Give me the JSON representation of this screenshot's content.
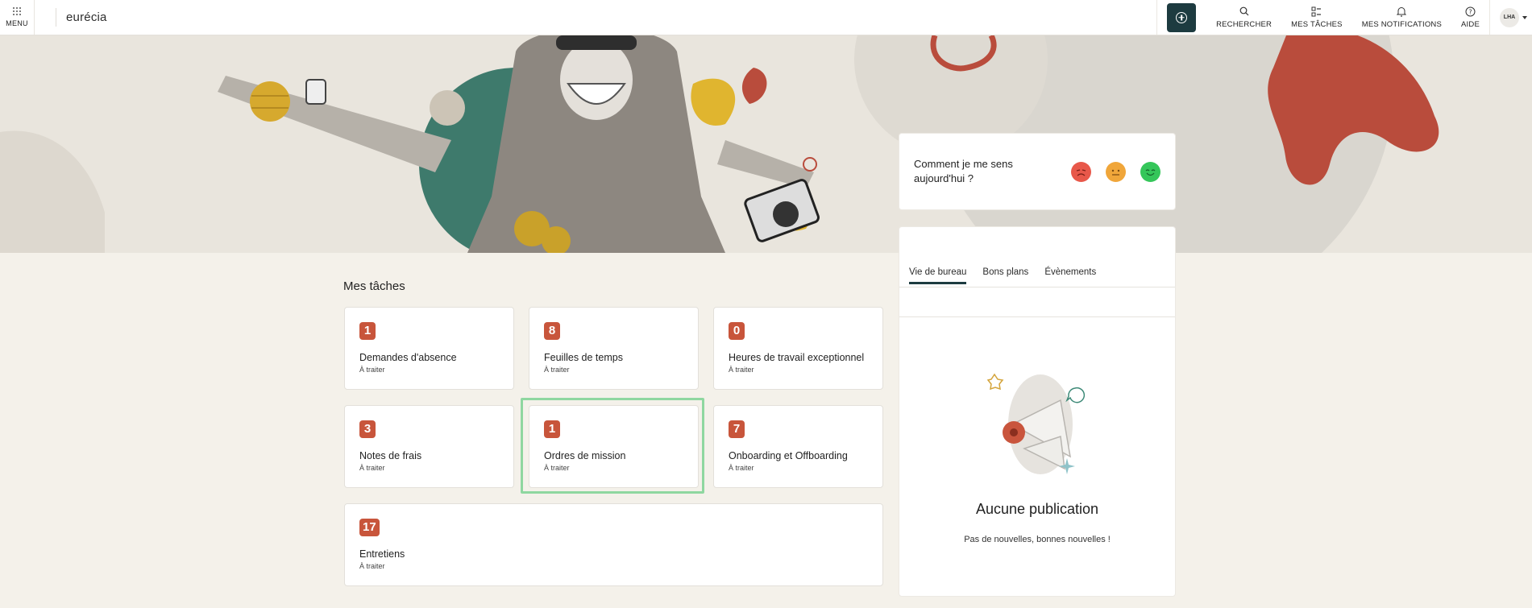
{
  "topbar": {
    "menu_label": "MENU",
    "logo": "eurécia",
    "nav": [
      {
        "label": "RECHERCHER",
        "icon": "search-icon"
      },
      {
        "label": "MES TÂCHES",
        "icon": "tasks-icon"
      },
      {
        "label": "MES NOTIFICATIONS",
        "icon": "bell-icon"
      },
      {
        "label": "AIDE",
        "icon": "help-icon"
      }
    ],
    "avatar": "LHA"
  },
  "mood": {
    "question": "Comment je me sens aujourd'hui ?",
    "colors": {
      "bad": "#e8584a",
      "neutral": "#f0a63a",
      "good": "#35c65a"
    }
  },
  "news": {
    "tabs": [
      "Vie de bureau",
      "Bons plans",
      "Évènements"
    ],
    "active_tab": "Vie de bureau",
    "empty_title": "Aucune publication",
    "empty_subtitle": "Pas de nouvelles, bonnes nouvelles !"
  },
  "tasks": {
    "title": "Mes tâches",
    "items": [
      {
        "count": "1",
        "label": "Demandes d'absence",
        "status": "À traiter"
      },
      {
        "count": "8",
        "label": "Feuilles de temps",
        "status": "À traiter"
      },
      {
        "count": "0",
        "label": "Heures de travail exceptionnel",
        "status": "À traiter"
      },
      {
        "count": "3",
        "label": "Notes de frais",
        "status": "À traiter"
      },
      {
        "count": "1",
        "label": "Ordres de mission",
        "status": "À traiter"
      },
      {
        "count": "7",
        "label": "Onboarding et Offboarding",
        "status": "À traiter"
      },
      {
        "count": "17",
        "label": "Entretiens",
        "status": "À traiter"
      }
    ]
  },
  "colors": {
    "accent": "#1d3b40",
    "badge": "#c8553b",
    "highlight": "#8fd7a0"
  }
}
